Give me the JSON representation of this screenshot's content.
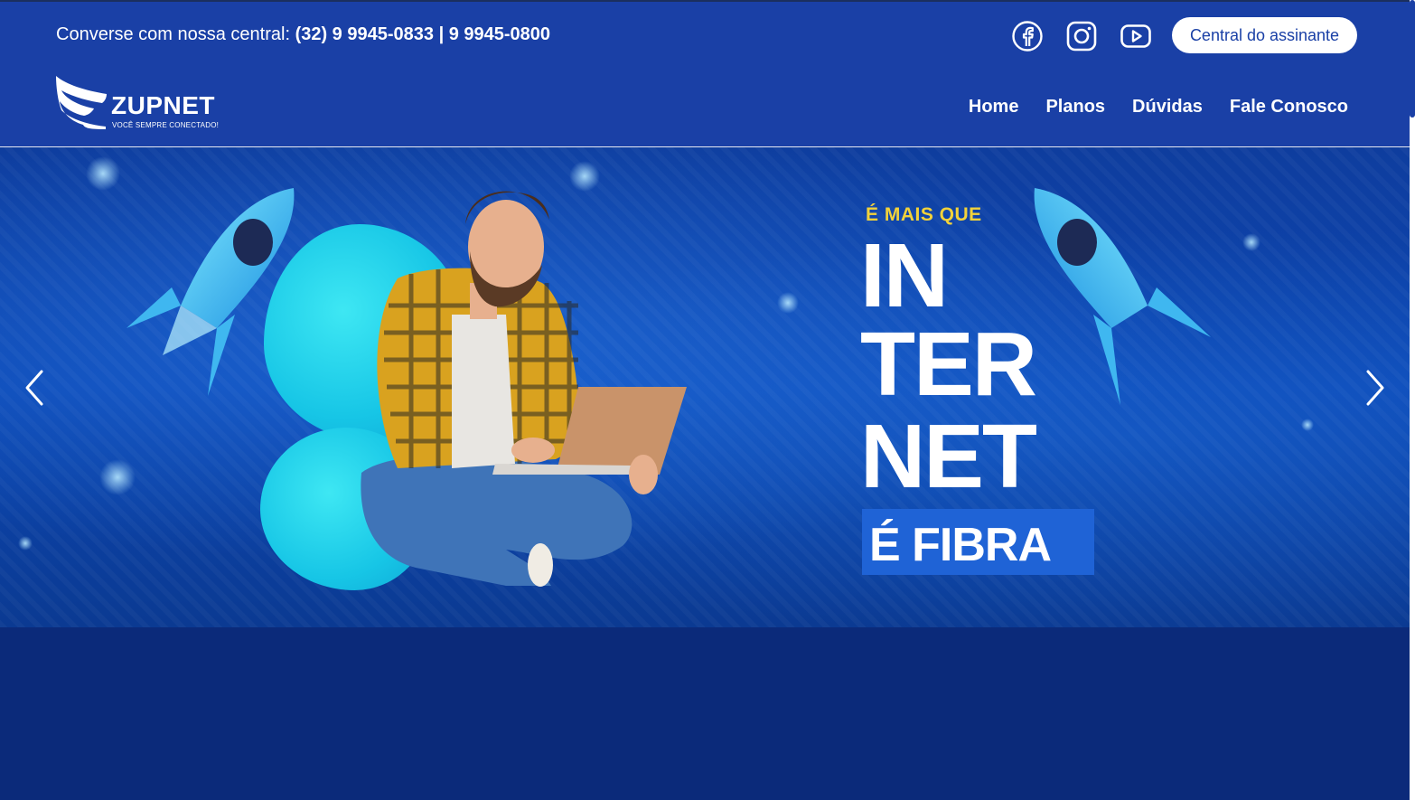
{
  "topbar": {
    "prefix": "Converse com nossa central: ",
    "phones": "(32) 9 9945-0833 | 9 9945-0800",
    "cta_label": "Central do assinante"
  },
  "social": [
    "facebook-icon",
    "instagram-icon",
    "youtube-icon"
  ],
  "logo": {
    "wordmark": "ZUPNET",
    "tagline": "VOCÊ SEMPRE CONECTADO!"
  },
  "nav": {
    "items": [
      {
        "label": "Home"
      },
      {
        "label": "Planos"
      },
      {
        "label": "Dúvidas"
      },
      {
        "label": "Fale Conosco"
      }
    ]
  },
  "hero": {
    "kicker": "É MAIS QUE",
    "line1": "IN",
    "line2": "TER",
    "line3": "NET",
    "line4": "É FIBRA"
  },
  "colors": {
    "header": "#1a40a6",
    "page": "#0b2a7a",
    "accent_yellow": "#f2d23a",
    "cyan": "#17c6e6"
  }
}
